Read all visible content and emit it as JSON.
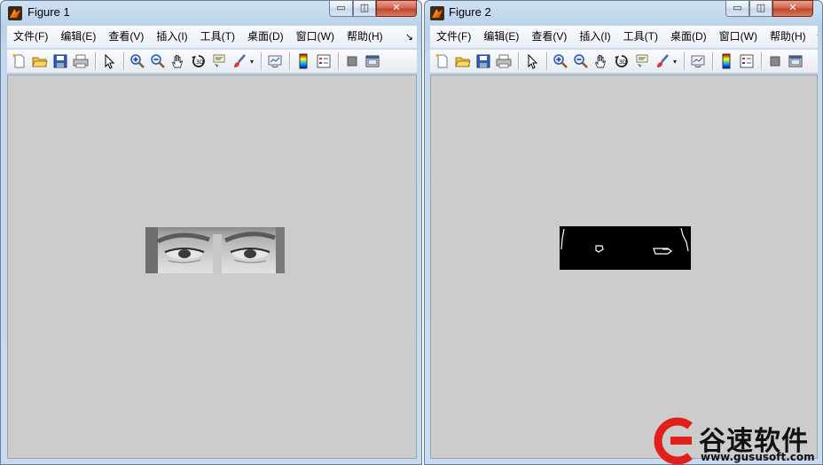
{
  "windows": [
    {
      "title": "Figure 1",
      "menu": [
        "文件(F)",
        "编辑(E)",
        "查看(V)",
        "插入(I)",
        "工具(T)",
        "桌面(D)",
        "窗口(W)",
        "帮助(H)"
      ],
      "menu_more": "↘"
    },
    {
      "title": "Figure 2",
      "menu": [
        "文件(F)",
        "编辑(E)",
        "查看(V)",
        "插入(I)",
        "工具(T)",
        "桌面(D)",
        "窗口(W)",
        "帮助(H)"
      ],
      "menu_more": "↘"
    }
  ],
  "caption_buttons": {
    "minimize": "▭",
    "maximize": "◫",
    "close": "✕"
  },
  "toolbar_icons": [
    "new-figure-icon",
    "open-file-icon",
    "save-icon",
    "print-icon",
    "edit-plot-arrow-icon",
    "zoom-in-icon",
    "zoom-out-icon",
    "pan-hand-icon",
    "rotate-3d-icon",
    "data-cursor-icon",
    "brush-icon",
    "link-plot-icon",
    "insert-colorbar-icon",
    "insert-legend-icon",
    "hide-plot-tools-icon",
    "show-plot-tools-icon"
  ],
  "colors": {
    "figure_background": "#cccccc",
    "close_button": "#c9452b",
    "watermark_red": "#e0201b"
  },
  "watermark": {
    "name": "谷速软件",
    "url": "www.gususoft.com"
  }
}
